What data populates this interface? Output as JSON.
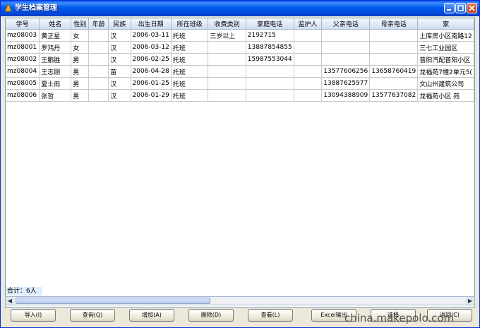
{
  "window": {
    "title": "学生档案管理"
  },
  "table": {
    "columns": [
      "学号",
      "姓名",
      "性别",
      "年龄",
      "民族",
      "出生日期",
      "所在班级",
      "收费类别",
      "家庭电话",
      "监护人",
      "父亲电话",
      "母亲电话",
      "家"
    ],
    "rows": [
      [
        "mz08003",
        "黄正星",
        "女",
        "",
        "汉",
        "2006-03-11",
        "托班",
        "三岁以上",
        "2192715",
        "",
        "",
        "",
        "土库房小区南路12"
      ],
      [
        "mz08001",
        "罗鸿丹",
        "女",
        "",
        "汉",
        "2006-03-12",
        "托班",
        "",
        "13887854855",
        "",
        "",
        "",
        "三七工业园区"
      ],
      [
        "mz08002",
        "王鹏胜",
        "男",
        "",
        "汉",
        "2006-02-25",
        "托班",
        "",
        "15987553044",
        "",
        "",
        "",
        "普阳汽配普阳小区"
      ],
      [
        "mz08004",
        "王志刚",
        "男",
        "",
        "苗",
        "2006-04-28",
        "托班",
        "",
        "",
        "",
        "13577606256",
        "13658760419",
        "龙福苑7幢2单元5("
      ],
      [
        "mz08005",
        "夏士雨",
        "男",
        "",
        "汉",
        "2006-01-25",
        "托班",
        "",
        "",
        "",
        "13887625977",
        "",
        "文山州建筑公司"
      ],
      [
        "mz08006",
        "张哲",
        "男",
        "",
        "汉",
        "2006-01-29",
        "托班",
        "",
        "",
        "",
        "13094388909",
        "13577637082",
        "龙福苑小区 苑"
      ]
    ]
  },
  "status": {
    "total": "合计：6人"
  },
  "buttons": {
    "import": "导入(I)",
    "query": "查询(Q)",
    "add": "增加(A)",
    "delete": "删除(D)",
    "view": "查看(L)",
    "excel": "Excel输出",
    "select": "选择",
    "back": "返回(C)"
  },
  "watermark": "china.makepolo.com"
}
